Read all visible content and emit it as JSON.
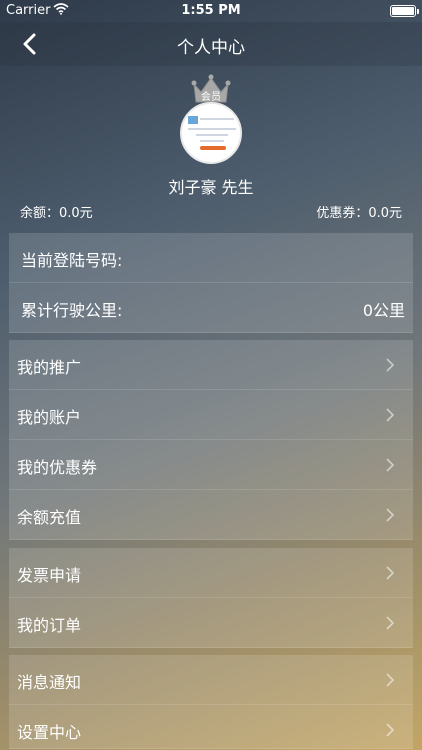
{
  "status": {
    "carrier": "Carrier",
    "time": "1:55 PM"
  },
  "nav": {
    "title": "个人中心"
  },
  "profile": {
    "badge": "会员",
    "name": "刘子豪 先生",
    "balance": "余额：0.0元",
    "coupon": "优惠券：0.0元"
  },
  "info": {
    "phone_label": "当前登陆号码:",
    "mileage_label": "累计行驶公里:",
    "mileage_value": "0公里"
  },
  "menu1": [
    "我的推广",
    "我的账户",
    "我的优惠券",
    "余额充值"
  ],
  "menu2": [
    "发票申请",
    "我的订单"
  ],
  "menu3": [
    "消息通知",
    "设置中心"
  ],
  "colors": {
    "accent": "#c3a666",
    "dark": "#2e3a49"
  }
}
